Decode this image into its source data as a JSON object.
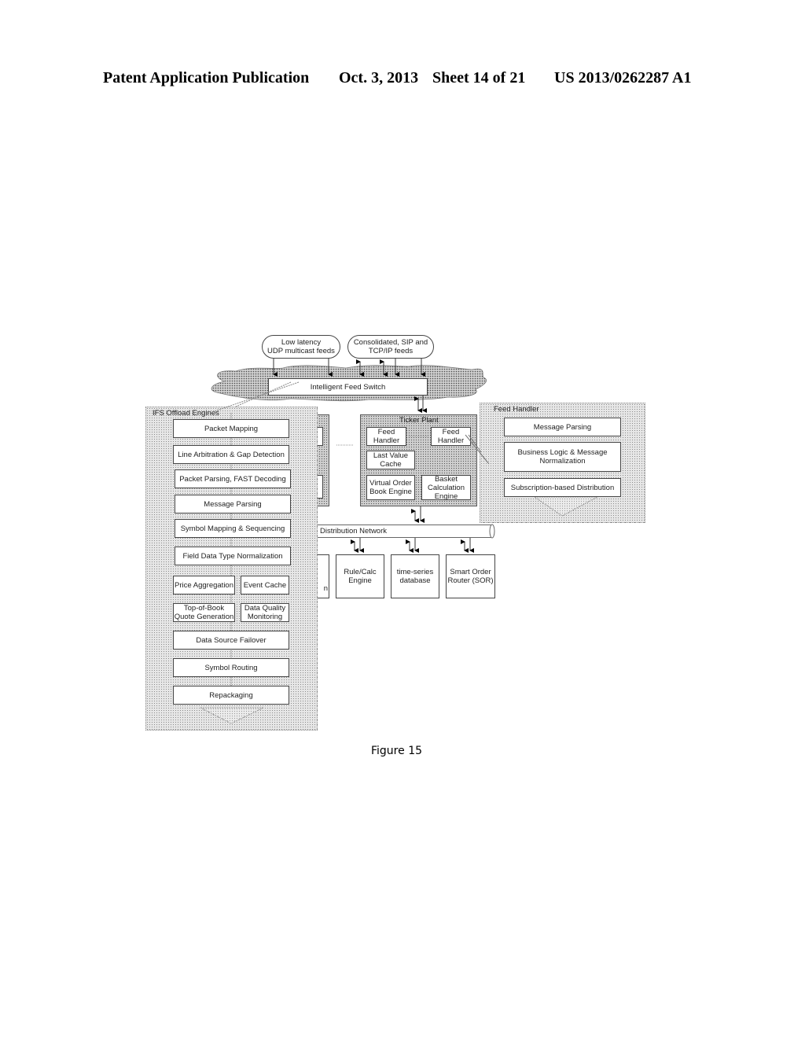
{
  "header": {
    "publication": "Patent Application Publication",
    "date": "Oct. 3, 2013",
    "sheet": "Sheet 14 of 21",
    "number": "US 2013/0262287 A1"
  },
  "feeds": {
    "low_latency": "Low latency\nUDP multicast feeds",
    "consolidated": "Consolidated, SIP and\nTCP/IP feeds"
  },
  "switch": {
    "label": "Intelligent Feed Switch"
  },
  "ifs_offload": {
    "title": "IFS Offload Engines",
    "stages": [
      "Packet Mapping",
      "Line Arbitration & Gap Detection",
      "Packet Parsing, FAST Decoding",
      "Message Parsing",
      "Symbol Mapping & Sequencing",
      "Field Data Type Normalization",
      "Price Aggregation",
      "Event Cache",
      "Top-of-Book\nQuote Generation",
      "Data Quality\nMonitoring",
      "Data Source Failover",
      "Symbol Routing",
      "Repackaging"
    ]
  },
  "ticker_plant": {
    "title": "Ticker Plant",
    "components": [
      "Feed\nHandler",
      "Feed\nHandler",
      "Last Value\nCache",
      "Virtual Order\nBook Engine",
      "Basket\nCalculation\nEngine"
    ]
  },
  "feed_handler": {
    "title": "Feed Handler",
    "stages": [
      "Message Parsing",
      "Business Logic & Message\nNormalization",
      "Subscription-based Distribution"
    ]
  },
  "distribution": {
    "label": "Distribution Network",
    "consumers": [
      "Rule/Calc\nEngine",
      "time-series\ndatabase",
      "Smart Order\nRouter (SOR)"
    ],
    "partial_consumer_text": "n"
  },
  "caption": "Figure 15"
}
